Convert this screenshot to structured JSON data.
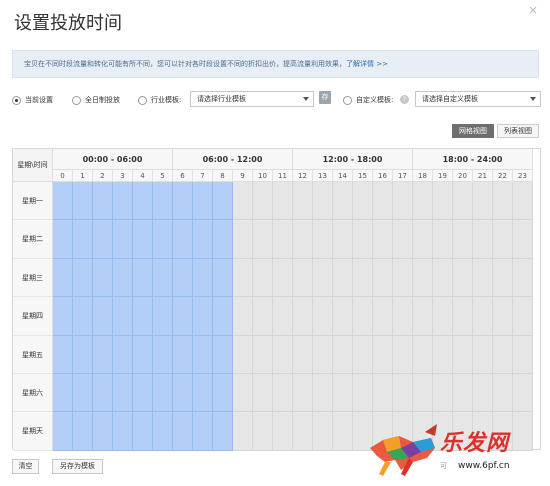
{
  "dialog": {
    "title": "设置投放时间",
    "close_icon": "×"
  },
  "notice": {
    "text": "宝贝在不同时段流量和转化可能有所不同，您可以针对各时段设置不同的折扣出价，提高流量利用效果，",
    "link": "了解详情 >>"
  },
  "options": {
    "current": "当前设置",
    "all_day": "全日制投放",
    "industry_label": "行业模板:",
    "industry_select": "请选择行业模板",
    "save_icon": "存",
    "custom_label": "自定义模板:",
    "custom_select": "请选择自定义模板",
    "help_icon": "?",
    "selected": "current"
  },
  "views": {
    "grid": "网格视图",
    "list": "列表视图",
    "active": "grid"
  },
  "schedule": {
    "corner": "星期\\时间",
    "ranges": [
      "00:00 - 06:00",
      "06:00 - 12:00",
      "12:00 - 18:00",
      "18:00 - 24:00"
    ],
    "hours": [
      "0",
      "1",
      "2",
      "3",
      "4",
      "5",
      "6",
      "7",
      "8",
      "9",
      "10",
      "11",
      "12",
      "13",
      "14",
      "15",
      "16",
      "17",
      "18",
      "19",
      "20",
      "21",
      "22",
      "23"
    ],
    "days": [
      "星期一",
      "星期二",
      "星期三",
      "星期四",
      "星期五",
      "星期六",
      "星期天"
    ],
    "active_hours": [
      0,
      1,
      2,
      3,
      4,
      5,
      6,
      7,
      8
    ],
    "active_color": "#b3cff7",
    "inactive_color": "#e6e6e6"
  },
  "footer": {
    "clear": "清空",
    "save_template": "另存为模板",
    "note": "可"
  },
  "watermark": {
    "text": "乐发网",
    "url": "www.6pf.cn"
  }
}
